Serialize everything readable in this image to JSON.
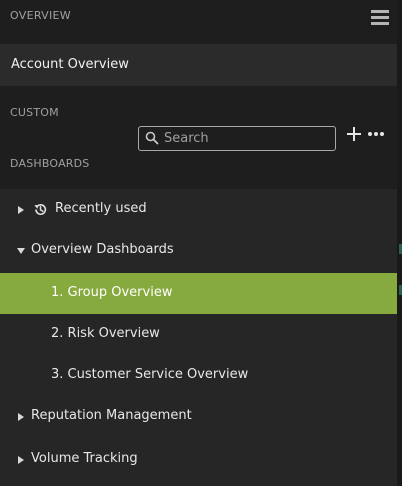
{
  "header": {
    "title": "OVERVIEW",
    "menu_icon": "hamburger-menu-icon"
  },
  "account_overview": {
    "label": "Account Overview"
  },
  "custom_dashboards": {
    "label_line1": "CUSTOM",
    "label_line2": "DASHBOARDS",
    "search": {
      "placeholder": "Search",
      "value": "",
      "icon": "search-icon"
    },
    "add_icon": "plus-icon",
    "more_icon": "more-dots-icon"
  },
  "tree": {
    "recently_used": {
      "label": "Recently used",
      "icon": "history-icon",
      "expanded": false
    },
    "overview_dashboards": {
      "label": "Overview Dashboards",
      "expanded": true,
      "children": [
        {
          "label": "1. Group Overview",
          "selected": true
        },
        {
          "label": "2. Risk Overview",
          "selected": false
        },
        {
          "label": "3. Customer Service Overview",
          "selected": false
        }
      ]
    },
    "reputation_management": {
      "label": "Reputation Management",
      "expanded": false
    },
    "volume_tracking": {
      "label": "Volume Tracking",
      "expanded": false
    }
  },
  "colors": {
    "selected_row": "#87aa3e",
    "panel_bg": "#262626",
    "header_bg": "#1e1e1e"
  }
}
